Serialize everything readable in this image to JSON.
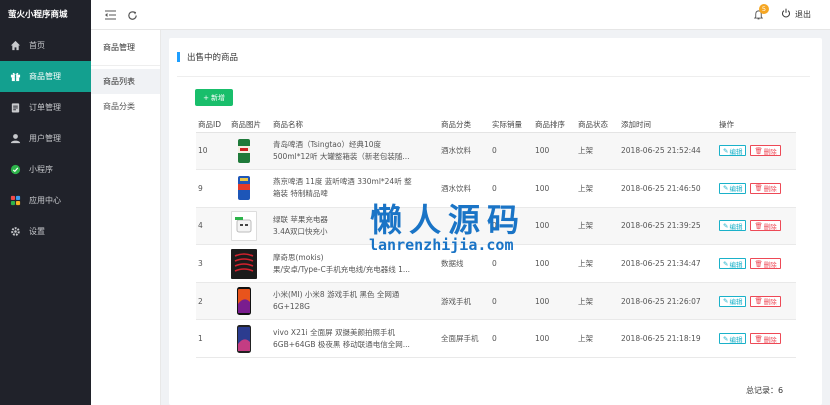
{
  "app": {
    "brand": "萤火小程序商城"
  },
  "sidebar": {
    "items": [
      {
        "label": "首页",
        "icon": "home-icon"
      },
      {
        "label": "商品管理",
        "icon": "gift-icon",
        "active": true
      },
      {
        "label": "订单管理",
        "icon": "clipboard-icon"
      },
      {
        "label": "用户管理",
        "icon": "user-icon"
      },
      {
        "label": "小程序",
        "icon": "mini-program-icon"
      },
      {
        "label": "应用中心",
        "icon": "apps-icon"
      },
      {
        "label": "设置",
        "icon": "gear-icon"
      }
    ]
  },
  "subnav": {
    "title": "商品管理",
    "items": [
      {
        "label": "商品列表",
        "active": true
      },
      {
        "label": "商品分类"
      }
    ]
  },
  "topbar": {
    "notification_count": "5",
    "logout_label": "退出"
  },
  "card": {
    "title": "出售中的商品",
    "add_label": "新增"
  },
  "table": {
    "columns": [
      "商品ID",
      "商品图片",
      "商品名称",
      "商品分类",
      "实际销量",
      "商品排序",
      "商品状态",
      "添加时间",
      "操作"
    ],
    "rows": [
      {
        "id": "10",
        "name1": "青岛啤酒（Tsingtao）经典10度",
        "name2": "500ml*12听 大罐整箱装（新老包装随...",
        "category": "酒水饮料",
        "sales": "0",
        "sort": "100",
        "status": "上架",
        "time": "2018-06-25 21:52:44",
        "edit": "编辑",
        "delete": "删除"
      },
      {
        "id": "9",
        "name1": "燕京啤酒 11度 蓝听啤酒 330ml*24听 整",
        "name2": "箱装 特制精品啤",
        "category": "酒水饮料",
        "sales": "0",
        "sort": "100",
        "status": "上架",
        "time": "2018-06-25 21:46:50",
        "edit": "编辑",
        "delete": "删除"
      },
      {
        "id": "4",
        "name1": "绿联 苹果充电器",
        "name2": "3.4A双口快充小",
        "category": "",
        "sales": "0",
        "sort": "100",
        "status": "上架",
        "time": "2018-06-25 21:39:25",
        "edit": "编辑",
        "delete": "删除"
      },
      {
        "id": "3",
        "name1": "摩奇思(mokis)",
        "name2": "果/安卓/Type-C手机充电线/充电器线 1...",
        "category": "数据线",
        "sales": "0",
        "sort": "100",
        "status": "上架",
        "time": "2018-06-25 21:34:47",
        "edit": "编辑",
        "delete": "删除"
      },
      {
        "id": "2",
        "name1": "小米(MI) 小米8 游戏手机 黑色 全网通",
        "name2": "6G+128G",
        "category": "游戏手机",
        "sales": "0",
        "sort": "100",
        "status": "上架",
        "time": "2018-06-25 21:26:07",
        "edit": "编辑",
        "delete": "删除"
      },
      {
        "id": "1",
        "name1": "vivo X21i 全面屏 双摄美颜拍照手机",
        "name2": "6GB+64GB 极夜黑 移动联通电信全网...",
        "category": "全面屏手机",
        "sales": "0",
        "sort": "100",
        "status": "上架",
        "time": "2018-06-25 21:18:19",
        "edit": "编辑",
        "delete": "删除"
      }
    ]
  },
  "footer": {
    "total_label": "总记录：6"
  },
  "watermark": {
    "cn": "懒人源码",
    "en": "lanrenzhijia.com"
  },
  "colors": {
    "accent": "#13a08f",
    "sidebar_bg": "#20222a",
    "add_button": "#19be6b",
    "edit": "#1ab1c9",
    "delete": "#ed4956",
    "title_bar": "#1e9fff"
  }
}
